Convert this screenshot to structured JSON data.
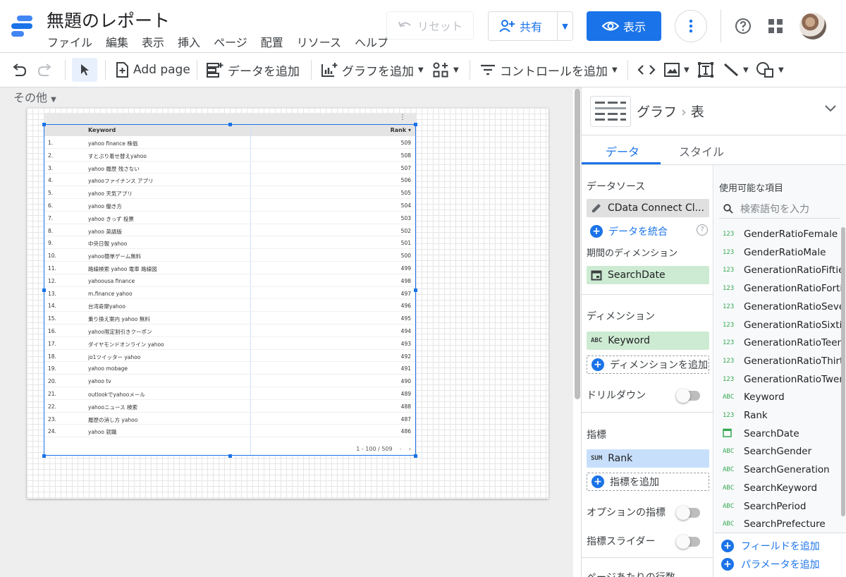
{
  "header": {
    "title": "無題のレポート",
    "menu": [
      "ファイル",
      "編集",
      "表示",
      "挿入",
      "ページ",
      "配置",
      "リソース",
      "ヘルプ"
    ],
    "reset_label": "リセット",
    "share_label": "共有",
    "view_label": "表示"
  },
  "toolbar": {
    "add_page": "Add page",
    "add_data": "データを追加",
    "add_chart": "グラフを追加",
    "add_control": "コントロールを追加"
  },
  "canvas": {
    "page_selector": "その他"
  },
  "table": {
    "headers": {
      "keyword": "Keyword",
      "rank": "Rank"
    },
    "rows": [
      {
        "n": "1.",
        "keyword": "yahoo finance 株価",
        "rank": "509"
      },
      {
        "n": "2.",
        "keyword": "すとぷり着せ替えyahoo",
        "rank": "508"
      },
      {
        "n": "3.",
        "keyword": "yahoo 履歴 残さない",
        "rank": "507"
      },
      {
        "n": "4.",
        "keyword": "yahooファイナンス アプリ",
        "rank": "506"
      },
      {
        "n": "5.",
        "keyword": "yahoo 天気アプリ",
        "rank": "505"
      },
      {
        "n": "6.",
        "keyword": "yahoo 働き方",
        "rank": "504"
      },
      {
        "n": "7.",
        "keyword": "yahoo きっず 投票",
        "rank": "503"
      },
      {
        "n": "8.",
        "keyword": "yahoo 英語版",
        "rank": "502"
      },
      {
        "n": "9.",
        "keyword": "中央日報 yahoo",
        "rank": "501"
      },
      {
        "n": "10.",
        "keyword": "yahoo簡単ゲーム無料",
        "rank": "500"
      },
      {
        "n": "11.",
        "keyword": "路線検索 yahoo 電車 路線図",
        "rank": "499"
      },
      {
        "n": "12.",
        "keyword": "yahoousa finance",
        "rank": "498"
      },
      {
        "n": "13.",
        "keyword": "m.finance yahoo",
        "rank": "497"
      },
      {
        "n": "14.",
        "keyword": "台湾奇摩yahoo",
        "rank": "496"
      },
      {
        "n": "15.",
        "keyword": "乗り換え案内 yahoo 無料",
        "rank": "495"
      },
      {
        "n": "16.",
        "keyword": "yahoo限定割引きクーポン",
        "rank": "494"
      },
      {
        "n": "17.",
        "keyword": "ダイヤモンドオンライン yahoo",
        "rank": "493"
      },
      {
        "n": "18.",
        "keyword": "jo1ツイッター yahoo",
        "rank": "492"
      },
      {
        "n": "19.",
        "keyword": "yahoo mobage",
        "rank": "491"
      },
      {
        "n": "20.",
        "keyword": "yahoo tv",
        "rank": "490"
      },
      {
        "n": "21.",
        "keyword": "outlookでyahooメール",
        "rank": "489"
      },
      {
        "n": "22.",
        "keyword": "yahooニュース 検索",
        "rank": "488"
      },
      {
        "n": "23.",
        "keyword": "履歴の消し方 yahoo",
        "rank": "487"
      },
      {
        "n": "24.",
        "keyword": "yahoo 就職",
        "rank": "486"
      }
    ],
    "pagination": "1 - 100 / 509"
  },
  "panel": {
    "chart_type_label": "グラフ",
    "chart_subtype": "表",
    "tabs": [
      "データ",
      "スタイル"
    ],
    "data_source_label": "データソース",
    "data_source_name": "CData Connect Cl...",
    "blend_data": "データを統合",
    "date_range_dim_label": "期間のディメンション",
    "date_range_dim": "SearchDate",
    "dimension_label": "ディメンション",
    "dimension_tag": "ABC",
    "dimension": "Keyword",
    "add_dimension": "ディメンションを追加",
    "drilldown_label": "ドリルダウン",
    "metric_label": "指標",
    "metric_tag": "SUM",
    "metric": "Rank",
    "add_metric": "指標を追加",
    "optional_metrics": "オプションの指標",
    "metric_slider": "指標スライダー",
    "cut_label": "ページあたりの行数"
  },
  "fields": {
    "title": "使用可能な項目",
    "search_placeholder": "検索語句を入力",
    "items": [
      {
        "type": "123",
        "name": "GenderRatioFemale"
      },
      {
        "type": "123",
        "name": "GenderRatioMale"
      },
      {
        "type": "123",
        "name": "GenerationRatioFifties"
      },
      {
        "type": "123",
        "name": "GenerationRatioForties"
      },
      {
        "type": "123",
        "name": "GenerationRatioSeven..."
      },
      {
        "type": "123",
        "name": "GenerationRatioSixties"
      },
      {
        "type": "123",
        "name": "GenerationRatioTeens..."
      },
      {
        "type": "123",
        "name": "GenerationRatioThirties"
      },
      {
        "type": "123",
        "name": "GenerationRatioTwent..."
      },
      {
        "type": "ABC",
        "name": "Keyword"
      },
      {
        "type": "123",
        "name": "Rank"
      },
      {
        "type": "date",
        "name": "SearchDate"
      },
      {
        "type": "ABC",
        "name": "SearchGender"
      },
      {
        "type": "ABC",
        "name": "SearchGeneration"
      },
      {
        "type": "ABC",
        "name": "SearchKeyword"
      },
      {
        "type": "ABC",
        "name": "SearchPeriod"
      },
      {
        "type": "ABC",
        "name": "SearchPrefecture"
      }
    ],
    "add_field": "フィールドを追加",
    "add_parameter": "パラメータを追加"
  },
  "colors": {
    "accent": "#1a73e8",
    "dimension_chip": "#cdebd2",
    "metric_chip": "#c7dffb"
  }
}
